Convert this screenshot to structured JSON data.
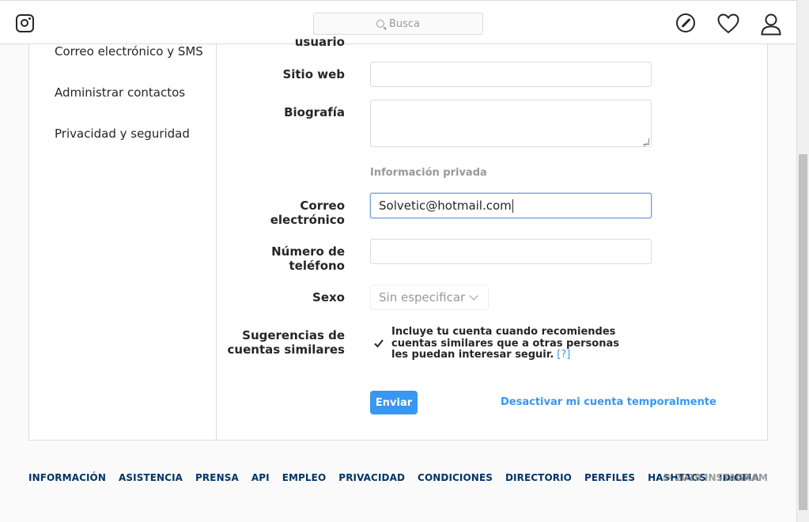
{
  "header": {
    "search_placeholder": "Busca"
  },
  "sidebar": {
    "items": [
      {
        "label": "Correo electrónico y SMS"
      },
      {
        "label": "Administrar contactos"
      },
      {
        "label": "Privacidad y seguridad"
      }
    ]
  },
  "form": {
    "username_label_fragment": "usuario",
    "website_label": "Sitio web",
    "website_value": "",
    "bio_label": "Biografía",
    "bio_value": "",
    "private_info_title": "Información privada",
    "email_label_line1": "Correo",
    "email_label_line2": "electrónico",
    "email_value": "Solvetic@hotmail.com",
    "phone_label_line1": "Número de",
    "phone_label_line2": "teléfono",
    "phone_value": "",
    "gender_label": "Sexo",
    "gender_value": "Sin especificar",
    "suggestions_label_line1": "Sugerencias de",
    "suggestions_label_line2": "cuentas similares",
    "suggestions_checked": true,
    "suggestions_text": "Incluye tu cuenta cuando recomiendes cuentas similares que a otras personas les puedan interesar seguir.",
    "suggestions_help": "[?]",
    "submit_label": "Enviar",
    "deactivate_label": "Desactivar mi cuenta temporalmente"
  },
  "footer": {
    "links": [
      "INFORMACIÓN",
      "ASISTENCIA",
      "PRENSA",
      "API",
      "EMPLEO",
      "PRIVACIDAD",
      "CONDICIONES",
      "DIRECTORIO",
      "PERFILES",
      "HASHTAGS",
      "IDIOMA"
    ],
    "copyright": "© 2019 INSTAGRAM"
  },
  "colors": {
    "accent": "#3897f0",
    "footer_link": "#003569",
    "border": "#dbdbdb"
  }
}
